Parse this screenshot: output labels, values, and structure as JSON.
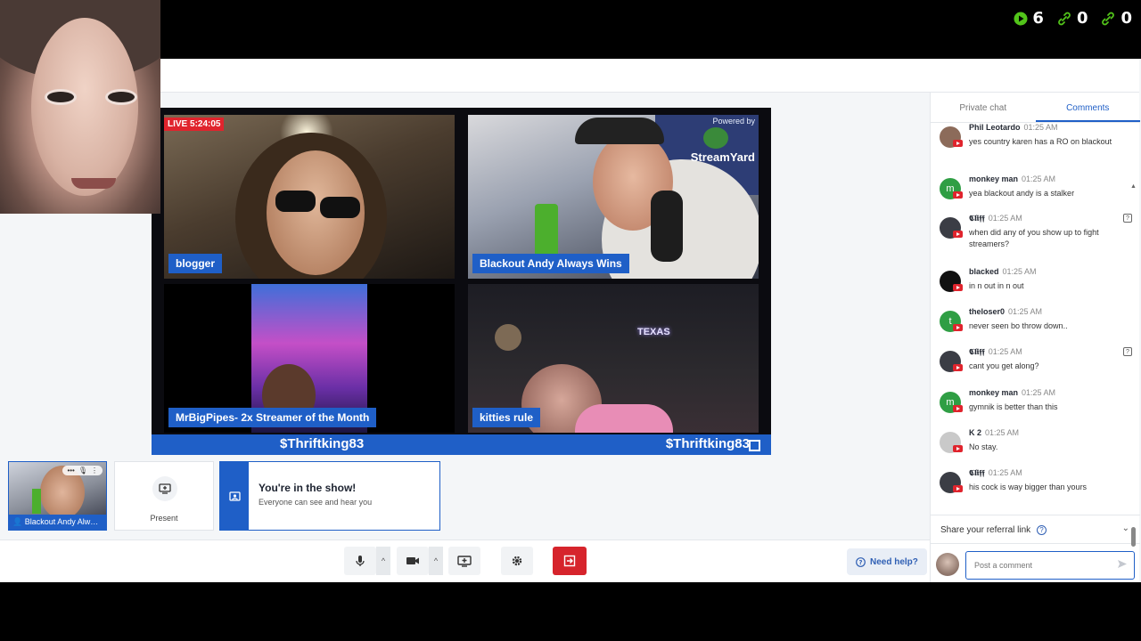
{
  "counters": [
    {
      "icon": "play-icon",
      "value": "6"
    },
    {
      "icon": "link-icon",
      "value": "0"
    },
    {
      "icon": "link-icon",
      "value": "0"
    }
  ],
  "broadcast": {
    "live_badge": "LIVE 5:24:05",
    "powered_by": "Powered by",
    "brand": "StreamYard",
    "tiles": [
      {
        "name": "blogger"
      },
      {
        "name": "Blackout Andy Always Wins"
      },
      {
        "name": "MrBigPipes- 2x Streamer of the Month"
      },
      {
        "name": "kitties rule"
      }
    ],
    "sign_text": "TEXAS",
    "ticker_left": "$Thriftking83",
    "ticker_right": "$Thriftking83"
  },
  "thumbnails": {
    "self_name": "Blackout Andy Always Wins",
    "present_label": "Present",
    "show_title": "You're in the show!",
    "show_subtitle": "Everyone can see and hear you"
  },
  "toolbar": {
    "help_label": "Need help?"
  },
  "side": {
    "tabs": [
      "Private chat",
      "Comments"
    ],
    "active_tab": "Comments",
    "comments": [
      {
        "author": "Phil Leotardo",
        "time": "01:25 AM",
        "message": "yes country karen has a RO on blackout",
        "avatar": "photo",
        "color": "#8c6b5a",
        "flag": false
      },
      {
        "author": "monkey man",
        "time": "01:25 AM",
        "message": "yea blackout andy is a stalker",
        "avatar": "m",
        "color": "#2f9e44",
        "flag": false
      },
      {
        "author": "𝕮𝖑𝖎𝖋𝖋",
        "time": "01:25 AM",
        "message": "when did any of you show up to fight streamers?",
        "avatar": "photo",
        "color": "#3b3d45",
        "flag": true
      },
      {
        "author": "blacked",
        "time": "01:25 AM",
        "message": "in n out in n out",
        "avatar": "",
        "color": "#111111",
        "flag": false
      },
      {
        "author": "theloser0",
        "time": "01:25 AM",
        "message": "never seen bo throw down..",
        "avatar": "t",
        "color": "#2f9e44",
        "flag": false
      },
      {
        "author": "𝕮𝖑𝖎𝖋𝖋",
        "time": "01:25 AM",
        "message": "cant you get along?",
        "avatar": "photo",
        "color": "#3b3d45",
        "flag": true
      },
      {
        "author": "monkey man",
        "time": "01:25 AM",
        "message": "gymnik is better than this",
        "avatar": "m",
        "color": "#2f9e44",
        "flag": false
      },
      {
        "author": "K 2",
        "time": "01:25 AM",
        "message": "No stay.",
        "avatar": "photo",
        "color": "#c9c9c9",
        "flag": false
      },
      {
        "author": "𝕮𝖑𝖎𝖋𝖋",
        "time": "01:25 AM",
        "message": "his cock is way bigger than yours",
        "avatar": "photo",
        "color": "#3b3d45",
        "flag": false
      }
    ],
    "referral_label": "Share your referral link",
    "post_placeholder": "Post a comment"
  },
  "colors": {
    "accent": "#1f5fc7",
    "live": "#e0242d",
    "leave": "#d6242c",
    "counter_green": "#52c41a"
  }
}
